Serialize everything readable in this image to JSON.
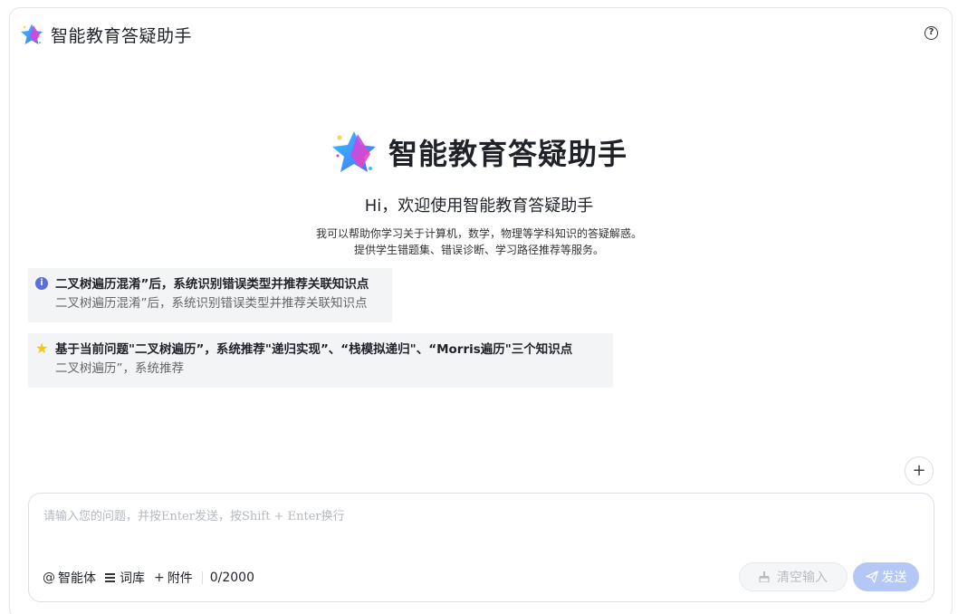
{
  "header": {
    "title": "智能教育答疑助手",
    "help_icon": "question-circle-icon",
    "help_glyph": "?"
  },
  "hero": {
    "title": "智能教育答疑助手",
    "greeting": "Hi，欢迎使用智能教育答疑助手",
    "desc_line1": "我可以帮助你学习关于计算机，数学，物理等学科知识的答疑解惑。",
    "desc_line2": "提供学生错题集、错误诊断、学习路径推荐等服务。"
  },
  "suggestions": [
    {
      "icon": "info-icon",
      "glyph": "i",
      "title": "二叉树遍历混淆”后，系统识别错误类型并推荐关联知识点",
      "desc": "二叉树遍历混淆”后，系统识别错误类型并推荐关联知识点"
    },
    {
      "icon": "star-icon",
      "glyph": "★",
      "title": "基于当前问题\"二叉树遍历”，系统推荐\"递归实现”、“栈模拟递归\"、“Morris遍历\"三个知识点",
      "desc": "二叉树遍历”，系统推荐"
    }
  ],
  "plus_glyph": "+",
  "composer": {
    "placeholder": "请输入您的问题，并按Enter发送，按Shift + Enter换行",
    "value": "",
    "tools": [
      {
        "icon": "at-icon",
        "glyph": "@",
        "label": "智能体"
      },
      {
        "icon": "list-icon",
        "label": "词库"
      },
      {
        "icon": "plus-icon",
        "glyph": "+",
        "label": "附件"
      }
    ],
    "counter": "0/2000",
    "clear_label": "清空输入",
    "send_label": "发送"
  },
  "colors": {
    "accent": "#5b6ee1",
    "send_disabled": "#b5c7f7",
    "card_bg": "#f3f4f6",
    "star": "#f5c518"
  }
}
